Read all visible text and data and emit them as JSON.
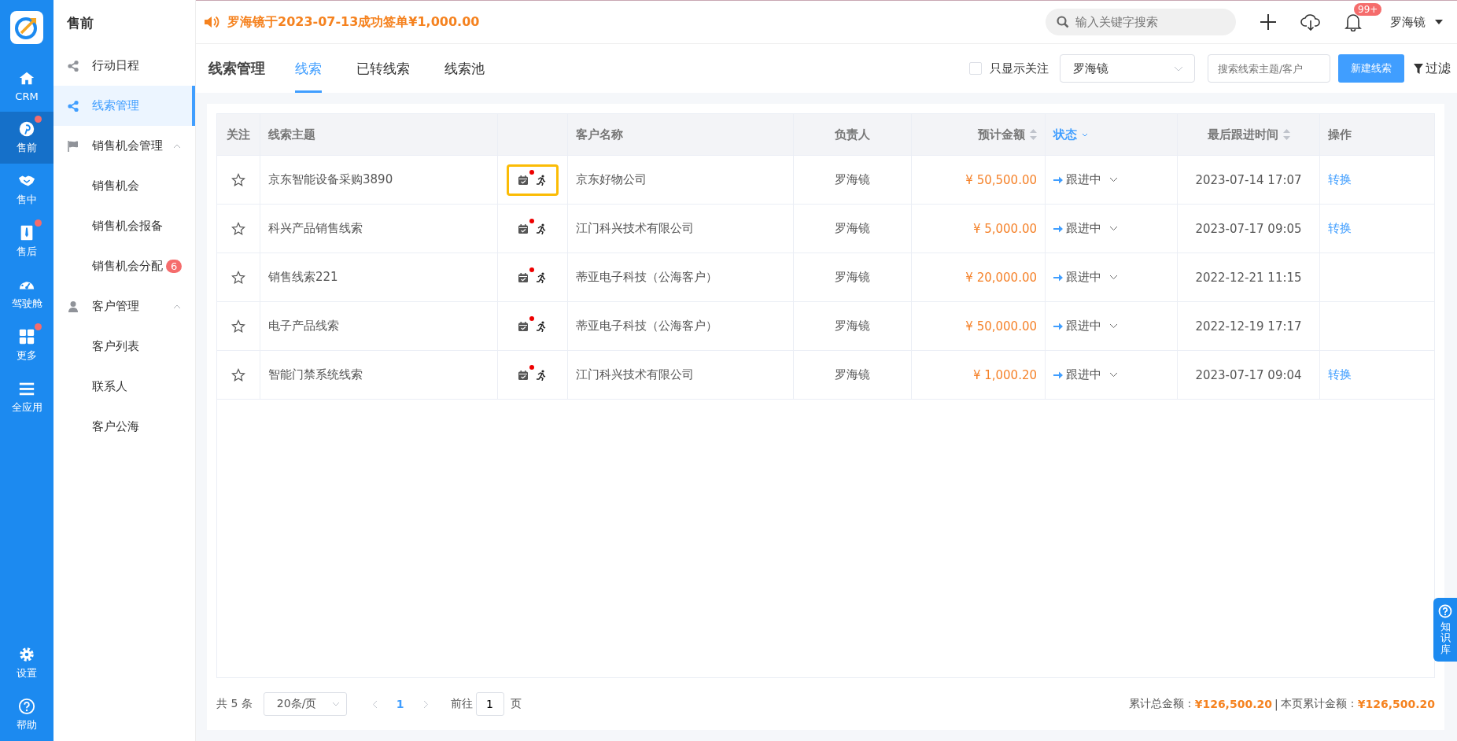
{
  "rail": {
    "items": [
      {
        "kind": "home",
        "label": "CRM",
        "selected": false,
        "dot": false
      },
      {
        "kind": "pin",
        "label": "售前",
        "selected": true,
        "dot": true
      },
      {
        "kind": "handshake",
        "label": "售中",
        "selected": false,
        "dot": false
      },
      {
        "kind": "tie",
        "label": "售后",
        "selected": false,
        "dot": true
      },
      {
        "kind": "gauge",
        "label": "驾驶舱",
        "selected": false,
        "dot": false
      },
      {
        "kind": "grid",
        "label": "更多",
        "selected": false,
        "dot": true
      },
      {
        "kind": "menu",
        "label": "全应用",
        "selected": false,
        "dot": false
      }
    ],
    "bottom": [
      {
        "kind": "gear",
        "label": "设置"
      },
      {
        "kind": "help",
        "label": "帮助"
      }
    ]
  },
  "menu": {
    "title": "售前",
    "items": [
      {
        "kind": "share",
        "label": "行动日程",
        "selected": false
      },
      {
        "kind": "share",
        "label": "线索管理",
        "selected": true
      },
      {
        "kind": "flag",
        "label": "销售机会管理",
        "selected": false,
        "expanded": true,
        "children": [
          {
            "label": "销售机会",
            "selected": false
          },
          {
            "label": "销售机会报备",
            "selected": false
          },
          {
            "label": "销售机会分配",
            "selected": false,
            "badge": "6"
          }
        ]
      },
      {
        "kind": "person",
        "label": "客户管理",
        "selected": false,
        "expanded": true,
        "children": [
          {
            "label": "客户列表",
            "selected": false
          },
          {
            "label": "联系人",
            "selected": false
          },
          {
            "label": "客户公海",
            "selected": false
          }
        ]
      }
    ]
  },
  "topbar": {
    "notice": "罗海镜于2023-07-13成功签单¥1,000.00",
    "search": {
      "placeholder": "输入关键字搜索"
    },
    "notifications": "99+",
    "user": "罗海镜"
  },
  "page": {
    "title": "线索管理",
    "tabs": [
      {
        "label": "线索",
        "selected": true
      },
      {
        "label": "已转线索",
        "selected": false
      },
      {
        "label": "线索池",
        "selected": false
      }
    ],
    "follow_only": {
      "label": "只显示关注",
      "checked": false
    },
    "owner_select": "罗海镜",
    "search": {
      "placeholder": "搜索线索主题/客户"
    },
    "new_button": "新建线索",
    "filter": "过滤"
  },
  "table": {
    "columns": [
      {
        "kind": "star",
        "label": "关注"
      },
      {
        "kind": "text",
        "label": "线索主题"
      },
      {
        "kind": "icons"
      },
      {
        "kind": "text",
        "label": "客户名称"
      },
      {
        "kind": "center",
        "label": "负责人"
      },
      {
        "kind": "amount",
        "label": "预计金额",
        "sortable": true
      },
      {
        "kind": "status",
        "label": "状态",
        "filtered": true
      },
      {
        "kind": "time",
        "label": "最后跟进时间",
        "sortable": true
      },
      {
        "kind": "action",
        "label": "操作"
      }
    ],
    "rows": [
      {
        "starred": false,
        "subject": "京东智能设备采购3890",
        "reminder": true,
        "highlighted": true,
        "customer": "京东好物公司",
        "owner": "罗海镜",
        "amount": "¥ 50,500.00",
        "status": "跟进中",
        "last_follow": "2023-07-14 17:07",
        "action": "转换"
      },
      {
        "starred": false,
        "subject": "科兴产品销售线索",
        "reminder": true,
        "highlighted": false,
        "customer": "江门科兴技术有限公司",
        "owner": "罗海镜",
        "amount": "¥ 5,000.00",
        "status": "跟进中",
        "last_follow": "2023-07-17 09:05",
        "action": "转换"
      },
      {
        "starred": false,
        "subject": "销售线索221",
        "reminder": true,
        "highlighted": false,
        "customer": "蒂亚电子科技（公海客户）",
        "owner": "罗海镜",
        "amount": "¥ 20,000.00",
        "status": "跟进中",
        "last_follow": "2022-12-21 11:15"
      },
      {
        "starred": false,
        "subject": "电子产品线索",
        "reminder": true,
        "highlighted": false,
        "customer": "蒂亚电子科技（公海客户）",
        "owner": "罗海镜",
        "amount": "¥ 50,000.00",
        "status": "跟进中",
        "last_follow": "2022-12-19 17:17"
      },
      {
        "starred": false,
        "subject": "智能门禁系统线索",
        "reminder": true,
        "highlighted": false,
        "customer": "江门科兴技术有限公司",
        "owner": "罗海镜",
        "amount": "¥ 1,000.20",
        "status": "跟进中",
        "last_follow": "2023-07-17 09:04",
        "action": "转换"
      }
    ]
  },
  "pager": {
    "total": "共 5 条",
    "page_size": "20条/页",
    "current": "1",
    "goto_label": "前往",
    "goto_value": "1",
    "page_unit": "页"
  },
  "totals": {
    "label_all": "累计总金额：",
    "value_all": "¥126,500.20",
    "separator": "|",
    "label_page": "本页累计金额：",
    "value_page": "¥126,500.20"
  },
  "help_tab": "知识库"
}
